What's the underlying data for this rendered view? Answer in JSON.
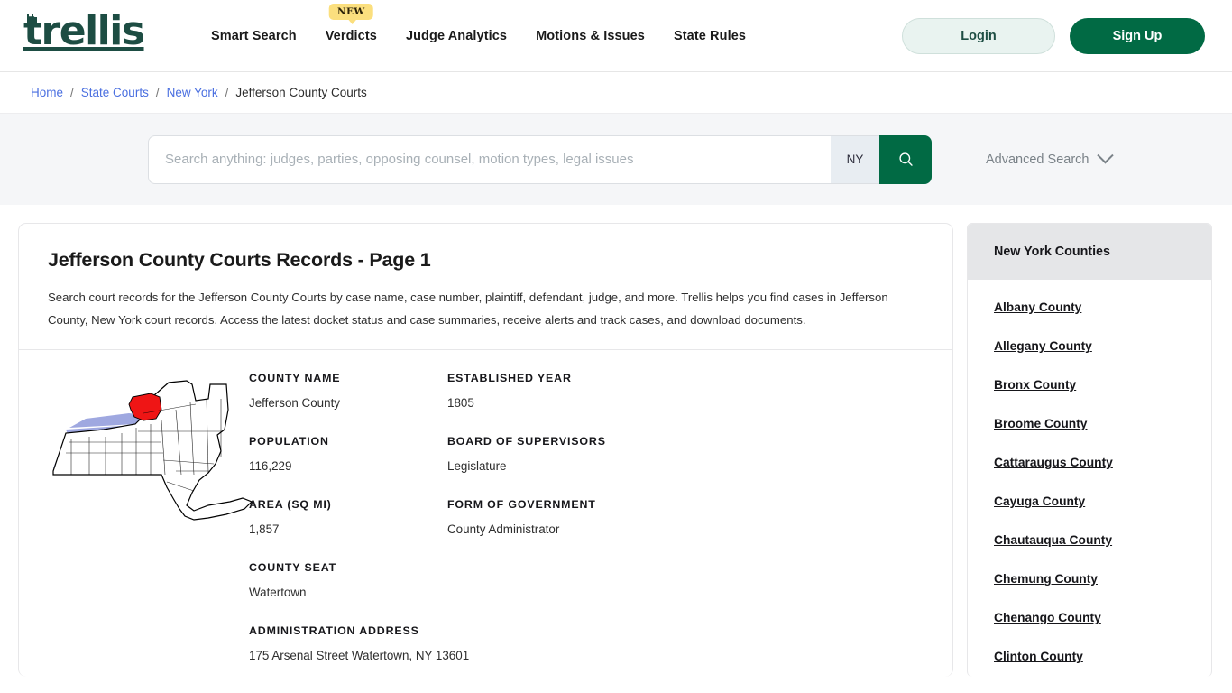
{
  "header": {
    "logo_text": "trellis",
    "nav": [
      {
        "label": "Smart Search",
        "badge": null
      },
      {
        "label": "Verdicts",
        "badge": "NEW"
      },
      {
        "label": "Judge Analytics",
        "badge": null
      },
      {
        "label": "Motions & Issues",
        "badge": null
      },
      {
        "label": "State Rules",
        "badge": null
      }
    ],
    "login_label": "Login",
    "signup_label": "Sign Up",
    "brand_color": "#1d4d43",
    "accent_color": "#016a44",
    "badge_color": "#fbdf7e"
  },
  "breadcrumb": {
    "items": [
      "Home",
      "State Courts",
      "New York",
      "Jefferson County Courts"
    ],
    "separator": "/",
    "link_color": "#4a6fe0"
  },
  "search": {
    "placeholder": "Search anything: judges, parties, opposing counsel, motion types, legal issues",
    "value": "",
    "state": "NY",
    "search_icon": "search-icon",
    "advanced_label": "Advanced Search",
    "chevron_icon": "chevron-down-icon"
  },
  "main": {
    "title": "Jefferson County Courts Records - Page 1",
    "description": "Search court records for the Jefferson County Courts by case name, case number, plaintiff, defendant, judge, and more. Trellis helps you find cases in Jefferson County, New York court records. Access the latest docket status and case summaries, receive alerts and track cases, and download documents.",
    "map_alt": "new-york-state-county-map",
    "fields_left": [
      {
        "label": "COUNTY NAME",
        "value": "Jefferson County"
      },
      {
        "label": "POPULATION",
        "value": "116,229"
      },
      {
        "label": "AREA (SQ MI)",
        "value": "1,857"
      },
      {
        "label": "COUNTY SEAT",
        "value": "Watertown"
      },
      {
        "label": "ADMINISTRATION ADDRESS",
        "value": "175 Arsenal Street Watertown, NY 13601"
      }
    ],
    "fields_right": [
      {
        "label": "ESTABLISHED YEAR",
        "value": "1805"
      },
      {
        "label": "BOARD OF SUPERVISORS",
        "value": "Legislature"
      },
      {
        "label": "FORM OF GOVERNMENT",
        "value": "County Administrator"
      }
    ]
  },
  "sidebar": {
    "title": "New York Counties",
    "counties": [
      "Albany County",
      "Allegany County",
      "Bronx County",
      "Broome County",
      "Cattaraugus County",
      "Cayuga County",
      "Chautauqua County",
      "Chemung County",
      "Chenango County",
      "Clinton County"
    ]
  }
}
